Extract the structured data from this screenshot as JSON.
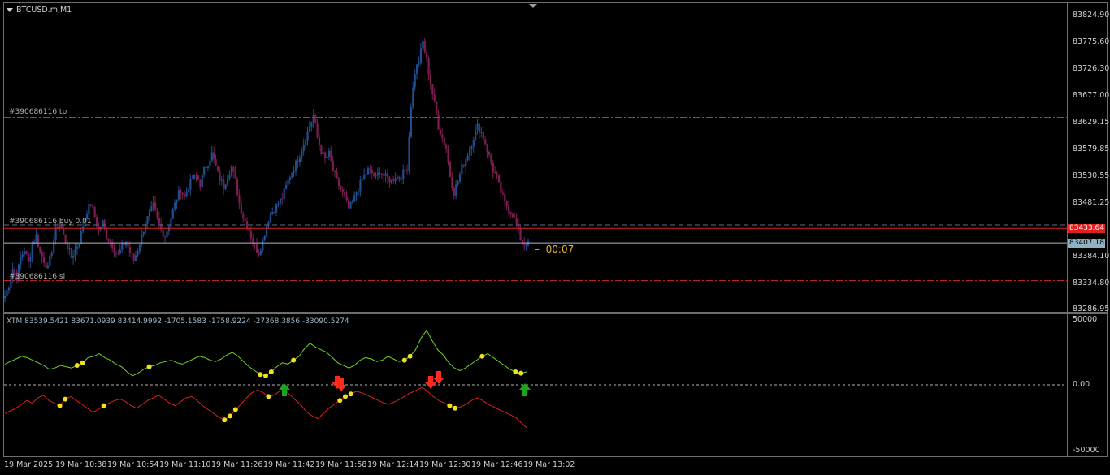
{
  "chart_title": "BTCUSD.m,M1",
  "indicator_title": "XTM 83539.5421 83671.0939 83414.9992 -1705.1583 -1758.9224 -27368.3856 -33090.5274",
  "timer": "00:07",
  "colors": {
    "background": "#000000",
    "bull_candle": "#1f4f8f",
    "bear_candle": "#7a1f4f",
    "order_line": "#d42a2a",
    "bid_line": "#a9b9c9",
    "ask_tag": "#e02020",
    "bid_tag": "#8fb1c2",
    "green_line": "#6fd12a",
    "red_line": "#e02020",
    "dot": "#f2e21a",
    "buy_arrow": "#19a61a",
    "sell_arrow": "#ff2a1a"
  },
  "price_axis": [
    "83824.90",
    "83775.60",
    "83726.30",
    "83677.00",
    "83629.15",
    "83579.85",
    "83530.55",
    "83481.25",
    "83433.64",
    "83407.18",
    "83384.10",
    "83334.80",
    "83286.95"
  ],
  "indicator_axis": [
    "50000",
    "0.00",
    "-50000"
  ],
  "time_axis": [
    "19 Mar 2025",
    "19 Mar 10:38",
    "19 Mar 10:54",
    "19 Mar 11:10",
    "19 Mar 11:26",
    "19 Mar 11:42",
    "19 Mar 11:58",
    "19 Mar 12:14",
    "19 Mar 12:30",
    "19 Mar 12:46",
    "19 Mar 13:02"
  ],
  "order_lines": {
    "tp_label": "#390686116 tp",
    "buy_label": "#390686116 buy 0.01",
    "sl_label": "#390686116 sl"
  },
  "price_tags": {
    "ask": "83433.64",
    "bid": "83407.18"
  },
  "chart_data": {
    "type": "candlestick",
    "price_range": [
      83286.95,
      83824.9
    ],
    "indicator_range": [
      -50000,
      50000
    ],
    "levels": {
      "tp": 83637,
      "buy": 83440,
      "sl": 83338,
      "ask": 83433.64,
      "bid": 83407.18
    },
    "close_series": [
      83310,
      83330,
      83360,
      83345,
      83380,
      83395,
      83370,
      83405,
      83420,
      83390,
      83375,
      83360,
      83395,
      83430,
      83445,
      83420,
      83400,
      83380,
      83395,
      83410,
      83440,
      83465,
      83480,
      83455,
      83430,
      83445,
      83420,
      83410,
      83395,
      83385,
      83400,
      83410,
      83390,
      83375,
      83395,
      83420,
      83445,
      83460,
      83475,
      83450,
      83430,
      83420,
      83440,
      83465,
      83490,
      83505,
      83490,
      83510,
      83525,
      83530,
      83515,
      83540,
      83555,
      83570,
      83545,
      83525,
      83510,
      83530,
      83545,
      83520,
      83480,
      83455,
      83440,
      83420,
      83400,
      83390,
      83410,
      83440,
      83460,
      83470,
      83480,
      83490,
      83510,
      83530,
      83545,
      83560,
      83580,
      83600,
      83620,
      83640,
      83600,
      83575,
      83560,
      83570,
      83540,
      83520,
      83505,
      83490,
      83470,
      83480,
      83500,
      83515,
      83530,
      83540,
      83535,
      83525,
      83540,
      83530,
      83525,
      83520,
      83530,
      83525,
      83535,
      83545,
      83660,
      83720,
      83740,
      83775,
      83740,
      83700,
      83660,
      83620,
      83600,
      83580,
      83530,
      83500,
      83520,
      83545,
      83560,
      83580,
      83600,
      83620,
      83610,
      83590,
      83565,
      83540,
      83525,
      83500,
      83480,
      83470,
      83460,
      83440,
      83415,
      83405,
      83410
    ],
    "green_series": [
      16000,
      18000,
      20000,
      22000,
      21000,
      19000,
      17000,
      15000,
      12000,
      13000,
      15000,
      14000,
      13000,
      15000,
      17000,
      21000,
      22000,
      24000,
      21000,
      19000,
      16000,
      14000,
      10000,
      7000,
      9000,
      12000,
      14000,
      15000,
      17000,
      18000,
      19000,
      17000,
      16000,
      18000,
      20000,
      22000,
      21000,
      19000,
      18000,
      20000,
      23000,
      25000,
      22000,
      18000,
      14000,
      11000,
      8000,
      7000,
      10000,
      14000,
      17000,
      16000,
      19000,
      22000,
      28000,
      32000,
      29000,
      27000,
      25000,
      21000,
      17000,
      15000,
      13000,
      15000,
      19000,
      21000,
      20000,
      18000,
      19000,
      22000,
      20000,
      18000,
      19000,
      22000,
      27000,
      36000,
      42000,
      34000,
      27000,
      23000,
      17000,
      13000,
      11000,
      13000,
      16000,
      19000,
      22000,
      24000,
      21000,
      18000,
      15000,
      12000,
      10000,
      9000,
      10000
    ],
    "red_series": [
      -22000,
      -20000,
      -18000,
      -15000,
      -12000,
      -14000,
      -10000,
      -8000,
      -12000,
      -14000,
      -16000,
      -11000,
      -9000,
      -12000,
      -15000,
      -18000,
      -21000,
      -19000,
      -16000,
      -14000,
      -12000,
      -11000,
      -13000,
      -16000,
      -18000,
      -15000,
      -12000,
      -10000,
      -8000,
      -11000,
      -14000,
      -16000,
      -13000,
      -10000,
      -9000,
      -12000,
      -16000,
      -19000,
      -22000,
      -25000,
      -27000,
      -24000,
      -19000,
      -15000,
      -10000,
      -6000,
      -4000,
      -6000,
      -9000,
      -8000,
      -5000,
      -4000,
      -8000,
      -12000,
      -16000,
      -21000,
      -24000,
      -26000,
      -22000,
      -18000,
      -15000,
      -12000,
      -9000,
      -7000,
      -5000,
      -6000,
      -8000,
      -10000,
      -12000,
      -14000,
      -15000,
      -13000,
      -11000,
      -8000,
      -6000,
      -4000,
      -2000,
      -5000,
      -9000,
      -12000,
      -14000,
      -16000,
      -18000,
      -17000,
      -15000,
      -12000,
      -10000,
      -12000,
      -15000,
      -17000,
      -19000,
      -21000,
      -23000,
      -25000,
      -29000,
      -33000
    ]
  }
}
